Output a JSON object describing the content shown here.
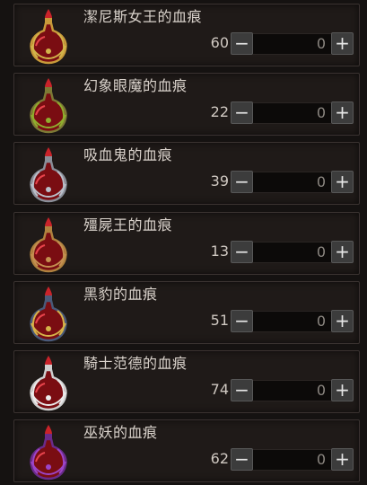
{
  "items": [
    {
      "name": "潔尼斯女王的血痕",
      "count": "60",
      "quantity": "0",
      "minus": "−",
      "plus": "+",
      "icon": "blood-vial-queen-zenith-icon",
      "cage": "#c89a3a",
      "accent": "#d2b44a"
    },
    {
      "name": "幻象眼魔的血痕",
      "count": "22",
      "quantity": "0",
      "minus": "−",
      "plus": "+",
      "icon": "blood-vial-illusion-eye-icon",
      "cage": "#7d7a35",
      "accent": "#8fae2e"
    },
    {
      "name": "吸血鬼的血痕",
      "count": "39",
      "quantity": "0",
      "minus": "−",
      "plus": "+",
      "icon": "blood-vial-vampire-icon",
      "cage": "#8a8f99",
      "accent": "#b9bfc9"
    },
    {
      "name": "殭屍王的血痕",
      "count": "13",
      "quantity": "0",
      "minus": "−",
      "plus": "+",
      "icon": "blood-vial-zombie-king-icon",
      "cage": "#b0823f",
      "accent": "#c49050"
    },
    {
      "name": "黑豹的血痕",
      "count": "51",
      "quantity": "0",
      "minus": "−",
      "plus": "+",
      "icon": "blood-vial-black-panther-icon",
      "cage": "#4a5a7a",
      "accent": "#d6b34a"
    },
    {
      "name": "騎士范德的血痕",
      "count": "74",
      "quantity": "0",
      "minus": "−",
      "plus": "+",
      "icon": "blood-vial-knight-vandor-icon",
      "cage": "#cfcfcf",
      "accent": "#ececec"
    },
    {
      "name": "巫妖的血痕",
      "count": "62",
      "quantity": "0",
      "minus": "−",
      "plus": "+",
      "icon": "blood-vial-lich-icon",
      "cage": "#6a2b8a",
      "accent": "#9c45c8"
    }
  ]
}
